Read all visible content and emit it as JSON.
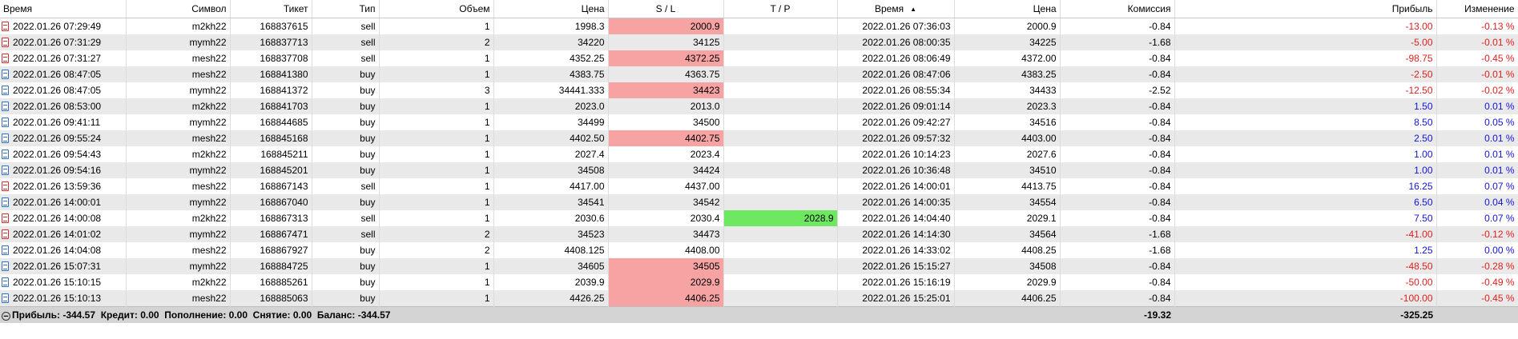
{
  "headers": [
    "Время",
    "Символ",
    "Тикет",
    "Тип",
    "Объем",
    "Цена",
    "S / L",
    "T / P",
    "Время",
    "Цена",
    "Комиссия",
    "Прибыль",
    "Изменение"
  ],
  "rows": [
    {
      "open_time": "2022.01.26 07:29:49",
      "symbol": "m2kh22",
      "ticket": "168837615",
      "type": "sell",
      "volume": "1",
      "open_price": "1998.3",
      "sl": "2000.9",
      "tp": "",
      "close_time": "2022.01.26 07:36:03",
      "close_price": "2000.9",
      "commission": "-0.84",
      "profit": "-13.00",
      "change": "-0.13 %",
      "sl_hit": true,
      "tp_hit": false,
      "sign": "neg"
    },
    {
      "open_time": "2022.01.26 07:31:29",
      "symbol": "mymh22",
      "ticket": "168837713",
      "type": "sell",
      "volume": "2",
      "open_price": "34220",
      "sl": "34125",
      "tp": "",
      "close_time": "2022.01.26 08:00:35",
      "close_price": "34225",
      "commission": "-1.68",
      "profit": "-5.00",
      "change": "-0.01 %",
      "sl_hit": false,
      "tp_hit": false,
      "sign": "neg"
    },
    {
      "open_time": "2022.01.26 07:31:27",
      "symbol": "mesh22",
      "ticket": "168837708",
      "type": "sell",
      "volume": "1",
      "open_price": "4352.25",
      "sl": "4372.25",
      "tp": "",
      "close_time": "2022.01.26 08:06:49",
      "close_price": "4372.00",
      "commission": "-0.84",
      "profit": "-98.75",
      "change": "-0.45 %",
      "sl_hit": true,
      "tp_hit": false,
      "sign": "neg"
    },
    {
      "open_time": "2022.01.26 08:47:05",
      "symbol": "mesh22",
      "ticket": "168841380",
      "type": "buy",
      "volume": "1",
      "open_price": "4383.75",
      "sl": "4363.75",
      "tp": "",
      "close_time": "2022.01.26 08:47:06",
      "close_price": "4383.25",
      "commission": "-0.84",
      "profit": "-2.50",
      "change": "-0.01 %",
      "sl_hit": false,
      "tp_hit": false,
      "sign": "neg"
    },
    {
      "open_time": "2022.01.26 08:47:05",
      "symbol": "mymh22",
      "ticket": "168841372",
      "type": "buy",
      "volume": "3",
      "open_price": "34441.333",
      "sl": "34423",
      "tp": "",
      "close_time": "2022.01.26 08:55:34",
      "close_price": "34433",
      "commission": "-2.52",
      "profit": "-12.50",
      "change": "-0.02 %",
      "sl_hit": true,
      "tp_hit": false,
      "sign": "neg"
    },
    {
      "open_time": "2022.01.26 08:53:00",
      "symbol": "m2kh22",
      "ticket": "168841703",
      "type": "buy",
      "volume": "1",
      "open_price": "2023.0",
      "sl": "2013.0",
      "tp": "",
      "close_time": "2022.01.26 09:01:14",
      "close_price": "2023.3",
      "commission": "-0.84",
      "profit": "1.50",
      "change": "0.01 %",
      "sl_hit": false,
      "tp_hit": false,
      "sign": "pos"
    },
    {
      "open_time": "2022.01.26 09:41:11",
      "symbol": "mymh22",
      "ticket": "168844685",
      "type": "buy",
      "volume": "1",
      "open_price": "34499",
      "sl": "34500",
      "tp": "",
      "close_time": "2022.01.26 09:42:27",
      "close_price": "34516",
      "commission": "-0.84",
      "profit": "8.50",
      "change": "0.05 %",
      "sl_hit": false,
      "tp_hit": false,
      "sign": "pos"
    },
    {
      "open_time": "2022.01.26 09:55:24",
      "symbol": "mesh22",
      "ticket": "168845168",
      "type": "buy",
      "volume": "1",
      "open_price": "4402.50",
      "sl": "4402.75",
      "tp": "",
      "close_time": "2022.01.26 09:57:32",
      "close_price": "4403.00",
      "commission": "-0.84",
      "profit": "2.50",
      "change": "0.01 %",
      "sl_hit": true,
      "tp_hit": false,
      "sign": "pos"
    },
    {
      "open_time": "2022.01.26 09:54:43",
      "symbol": "m2kh22",
      "ticket": "168845211",
      "type": "buy",
      "volume": "1",
      "open_price": "2027.4",
      "sl": "2023.4",
      "tp": "",
      "close_time": "2022.01.26 10:14:23",
      "close_price": "2027.6",
      "commission": "-0.84",
      "profit": "1.00",
      "change": "0.01 %",
      "sl_hit": false,
      "tp_hit": false,
      "sign": "pos"
    },
    {
      "open_time": "2022.01.26 09:54:16",
      "symbol": "mymh22",
      "ticket": "168845201",
      "type": "buy",
      "volume": "1",
      "open_price": "34508",
      "sl": "34424",
      "tp": "",
      "close_time": "2022.01.26 10:36:48",
      "close_price": "34510",
      "commission": "-0.84",
      "profit": "1.00",
      "change": "0.01 %",
      "sl_hit": false,
      "tp_hit": false,
      "sign": "pos"
    },
    {
      "open_time": "2022.01.26 13:59:36",
      "symbol": "mesh22",
      "ticket": "168867143",
      "type": "sell",
      "volume": "1",
      "open_price": "4417.00",
      "sl": "4437.00",
      "tp": "",
      "close_time": "2022.01.26 14:00:01",
      "close_price": "4413.75",
      "commission": "-0.84",
      "profit": "16.25",
      "change": "0.07 %",
      "sl_hit": false,
      "tp_hit": false,
      "sign": "pos"
    },
    {
      "open_time": "2022.01.26 14:00:01",
      "symbol": "mymh22",
      "ticket": "168867040",
      "type": "buy",
      "volume": "1",
      "open_price": "34541",
      "sl": "34542",
      "tp": "",
      "close_time": "2022.01.26 14:00:35",
      "close_price": "34554",
      "commission": "-0.84",
      "profit": "6.50",
      "change": "0.04 %",
      "sl_hit": false,
      "tp_hit": false,
      "sign": "pos"
    },
    {
      "open_time": "2022.01.26 14:00:08",
      "symbol": "m2kh22",
      "ticket": "168867313",
      "type": "sell",
      "volume": "1",
      "open_price": "2030.6",
      "sl": "2030.4",
      "tp": "2028.9",
      "close_time": "2022.01.26 14:04:40",
      "close_price": "2029.1",
      "commission": "-0.84",
      "profit": "7.50",
      "change": "0.07 %",
      "sl_hit": false,
      "tp_hit": true,
      "sign": "pos"
    },
    {
      "open_time": "2022.01.26 14:01:02",
      "symbol": "mymh22",
      "ticket": "168867471",
      "type": "sell",
      "volume": "2",
      "open_price": "34523",
      "sl": "34473",
      "tp": "",
      "close_time": "2022.01.26 14:14:30",
      "close_price": "34564",
      "commission": "-1.68",
      "profit": "-41.00",
      "change": "-0.12 %",
      "sl_hit": false,
      "tp_hit": false,
      "sign": "neg"
    },
    {
      "open_time": "2022.01.26 14:04:08",
      "symbol": "mesh22",
      "ticket": "168867927",
      "type": "buy",
      "volume": "2",
      "open_price": "4408.125",
      "sl": "4408.00",
      "tp": "",
      "close_time": "2022.01.26 14:33:02",
      "close_price": "4408.25",
      "commission": "-1.68",
      "profit": "1.25",
      "change": "0.00 %",
      "sl_hit": false,
      "tp_hit": false,
      "sign": "pos"
    },
    {
      "open_time": "2022.01.26 15:07:31",
      "symbol": "mymh22",
      "ticket": "168884725",
      "type": "buy",
      "volume": "1",
      "open_price": "34605",
      "sl": "34505",
      "tp": "",
      "close_time": "2022.01.26 15:15:27",
      "close_price": "34508",
      "commission": "-0.84",
      "profit": "-48.50",
      "change": "-0.28 %",
      "sl_hit": true,
      "tp_hit": false,
      "sign": "neg"
    },
    {
      "open_time": "2022.01.26 15:10:15",
      "symbol": "m2kh22",
      "ticket": "168885261",
      "type": "buy",
      "volume": "1",
      "open_price": "2039.9",
      "sl": "2029.9",
      "tp": "",
      "close_time": "2022.01.26 15:16:19",
      "close_price": "2029.9",
      "commission": "-0.84",
      "profit": "-50.00",
      "change": "-0.49 %",
      "sl_hit": true,
      "tp_hit": false,
      "sign": "neg"
    },
    {
      "open_time": "2022.01.26 15:10:13",
      "symbol": "mesh22",
      "ticket": "168885063",
      "type": "buy",
      "volume": "1",
      "open_price": "4426.25",
      "sl": "4406.25",
      "tp": "",
      "close_time": "2022.01.26 15:25:01",
      "close_price": "4406.25",
      "commission": "-0.84",
      "profit": "-100.00",
      "change": "-0.45 %",
      "sl_hit": true,
      "tp_hit": false,
      "sign": "neg"
    }
  ],
  "summary": {
    "text": "Прибыль: -344.57  Кредит: 0.00  Пополнение: 0.00  Снятие: 0.00  Баланс: -344.57",
    "commission_total": "-19.32",
    "profit_total": "-325.25"
  },
  "colors": {
    "sell_icon": "#d23030",
    "buy_icon": "#2d6fc4",
    "sl_hit": "#f7a3a3",
    "tp_hit": "#6ee860",
    "negative": "#e0201e",
    "positive": "#1414d8"
  },
  "icons": {
    "row_sell": "document-sell-icon",
    "row_buy": "document-buy-icon",
    "summary_toggle": "collapse-minus-icon",
    "sort": "sort-ascending-icon"
  }
}
